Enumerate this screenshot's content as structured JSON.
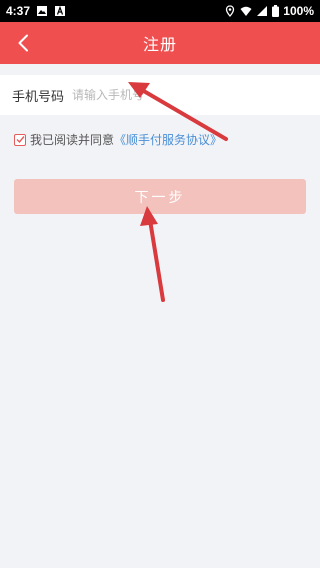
{
  "status_bar": {
    "time": "4:37",
    "battery": "100%"
  },
  "header": {
    "title": "注册",
    "back_icon": "chevron-left-icon"
  },
  "form": {
    "phone_label": "手机号码",
    "phone_placeholder": "请输入手机号",
    "phone_value": ""
  },
  "agreement": {
    "checked": true,
    "text": "我已阅读并同意",
    "link": "《顺手付服务协议》"
  },
  "actions": {
    "next_label": "下一步"
  },
  "colors": {
    "header_bg": "#f04f4f",
    "button_bg": "#f4c2bd",
    "link": "#4a8fd6",
    "annotation_arrow": "#d83a3e"
  }
}
